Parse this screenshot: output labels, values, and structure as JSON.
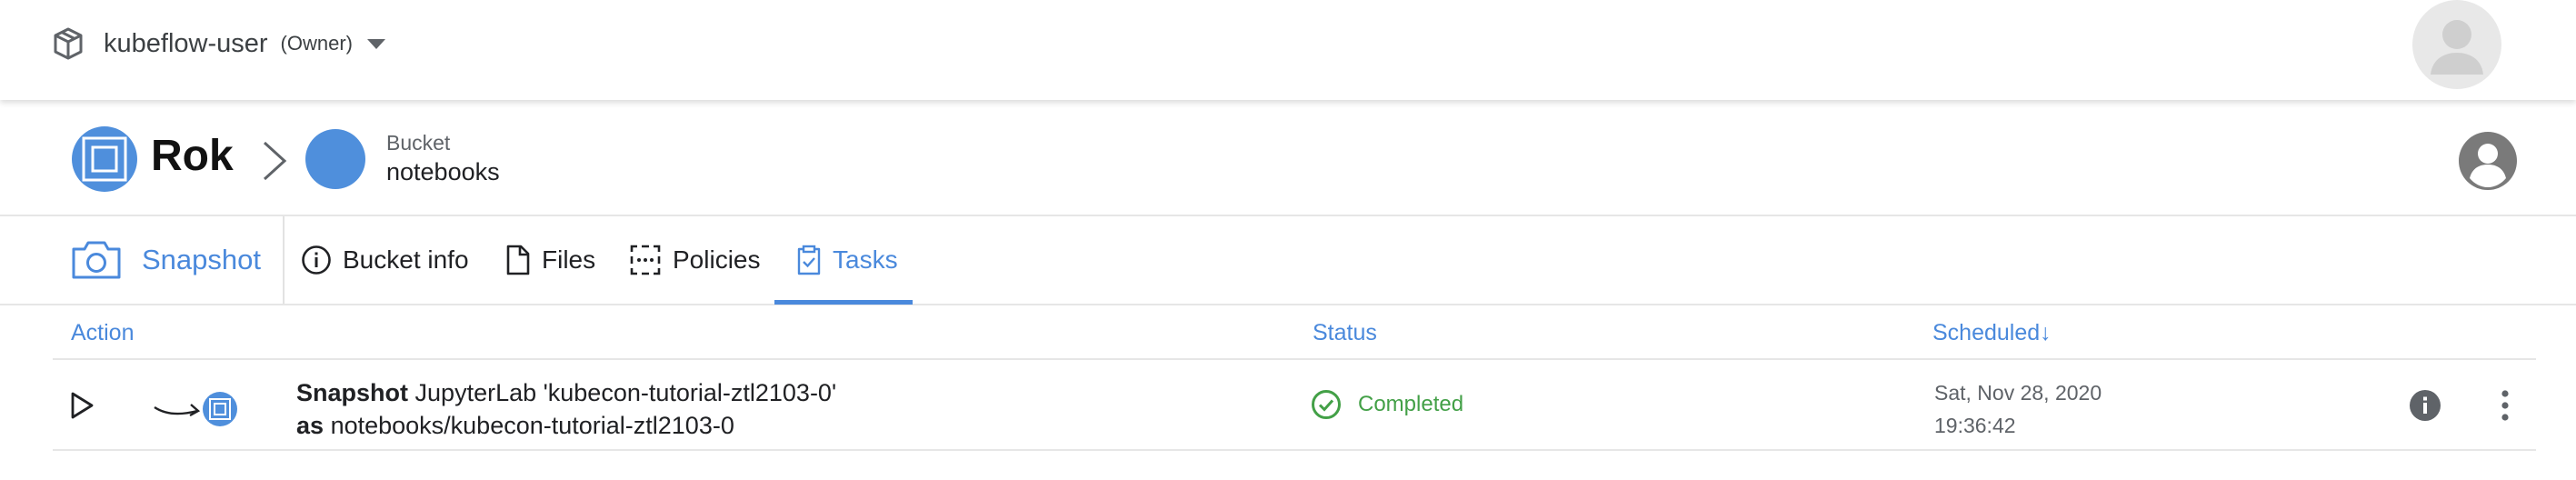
{
  "topbar": {
    "namespace": "kubeflow-user",
    "role": "(Owner)"
  },
  "header": {
    "app_title": "Rok",
    "bucket_kicker": "Bucket",
    "bucket_name": "notebooks"
  },
  "tabs": [
    {
      "label": "Snapshot",
      "icon": "camera-icon"
    },
    {
      "label": "Bucket info",
      "icon": "info-icon"
    },
    {
      "label": "Files",
      "icon": "file-icon"
    },
    {
      "label": "Policies",
      "icon": "policy-icon"
    },
    {
      "label": "Tasks",
      "icon": "clipboard-check-icon",
      "active": true
    }
  ],
  "table": {
    "headers": {
      "action": "Action",
      "status": "Status",
      "scheduled": "Scheduled↓"
    },
    "rows": [
      {
        "action_verb": "Snapshot",
        "action_target": "JupyterLab 'kubecon-tutorial-ztl2103-0'",
        "as_word": "as",
        "as_target": "notebooks/kubecon-tutorial-ztl2103-0",
        "status": "Completed",
        "date": "Sat, Nov 28, 2020",
        "time": "19:36:42"
      }
    ]
  },
  "colors": {
    "accent": "#4a89dc",
    "success": "#43a047",
    "text": "#202124",
    "muted": "#5f6368"
  }
}
